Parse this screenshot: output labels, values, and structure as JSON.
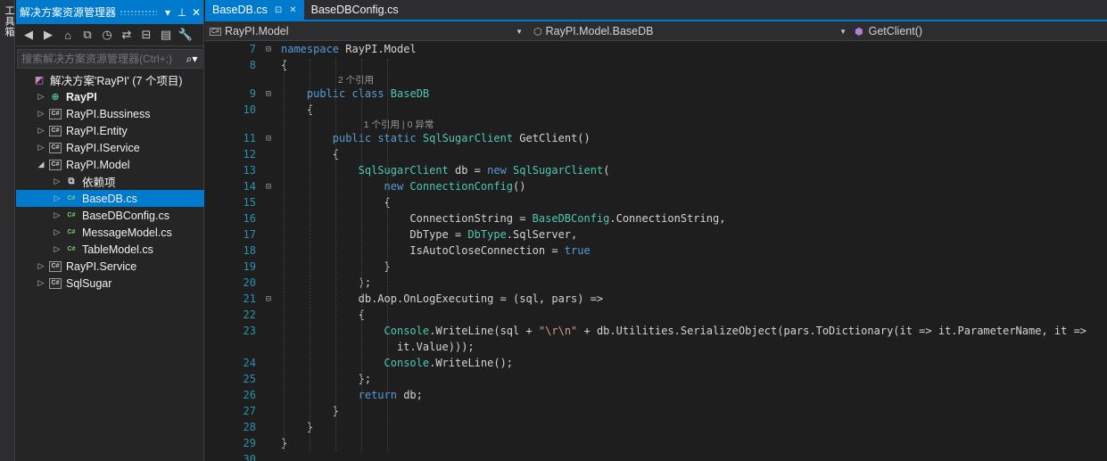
{
  "left_strip": {
    "label": "工具箱"
  },
  "solution_explorer": {
    "title": "解决方案资源管理器",
    "search_placeholder": "搜索解决方案资源管理器(Ctrl+;)",
    "tree": [
      {
        "label": "解决方案'RayPI' (7 个项目)",
        "icon": "solution-icon",
        "indent": 0,
        "arrow": "",
        "bold": false
      },
      {
        "label": "RayPI",
        "icon": "web-project-icon",
        "indent": 1,
        "arrow": "▷",
        "bold": true
      },
      {
        "label": "RayPI.Bussiness",
        "icon": "csproj-icon",
        "indent": 1,
        "arrow": "▷",
        "bold": false
      },
      {
        "label": "RayPI.Entity",
        "icon": "csproj-icon",
        "indent": 1,
        "arrow": "▷",
        "bold": false
      },
      {
        "label": "RayPI.IService",
        "icon": "csproj-icon",
        "indent": 1,
        "arrow": "▷",
        "bold": false
      },
      {
        "label": "RayPI.Model",
        "icon": "csproj-icon",
        "indent": 1,
        "arrow": "◢",
        "bold": false
      },
      {
        "label": "依赖项",
        "icon": "dependencies-icon",
        "indent": 2,
        "arrow": "▷",
        "bold": false
      },
      {
        "label": "BaseDB.cs",
        "icon": "csfile-icon",
        "indent": 2,
        "arrow": "▷",
        "bold": false,
        "selected": true
      },
      {
        "label": "BaseDBConfig.cs",
        "icon": "csfile-icon",
        "indent": 2,
        "arrow": "▷",
        "bold": false
      },
      {
        "label": "MessageModel.cs",
        "icon": "csfile-icon",
        "indent": 2,
        "arrow": "▷",
        "bold": false
      },
      {
        "label": "TableModel.cs",
        "icon": "csfile-icon",
        "indent": 2,
        "arrow": "▷",
        "bold": false
      },
      {
        "label": "RayPI.Service",
        "icon": "csproj-icon",
        "indent": 1,
        "arrow": "▷",
        "bold": false
      },
      {
        "label": "SqlSugar",
        "icon": "csproj-icon",
        "indent": 1,
        "arrow": "▷",
        "bold": false
      }
    ]
  },
  "editor": {
    "tabs": [
      {
        "label": "BaseDB.cs",
        "active": true
      },
      {
        "label": "BaseDBConfig.cs",
        "active": false
      }
    ],
    "nav": {
      "project": "RayPI.Model",
      "type": "RayPI.Model.BaseDB",
      "member": "GetClient()"
    },
    "lines": [
      {
        "no": "7",
        "fold": "⊟",
        "indent": 0,
        "tokens": [
          [
            "k",
            "namespace "
          ],
          [
            "",
            "RayPI.Model"
          ]
        ]
      },
      {
        "no": "8",
        "fold": "",
        "indent": 0,
        "tokens": [
          [
            "",
            "{"
          ]
        ]
      },
      {
        "lens": "2 个引用",
        "indent": 4
      },
      {
        "no": "9",
        "fold": "⊟",
        "indent": 4,
        "tokens": [
          [
            "k",
            "public class "
          ],
          [
            "t",
            "BaseDB"
          ]
        ]
      },
      {
        "no": "10",
        "fold": "",
        "indent": 4,
        "tokens": [
          [
            "",
            "{"
          ]
        ]
      },
      {
        "lens": "1 个引用 | 0 异常",
        "indent": 8
      },
      {
        "no": "11",
        "fold": "⊟",
        "indent": 8,
        "tokens": [
          [
            "k",
            "public static "
          ],
          [
            "t",
            "SqlSugarClient"
          ],
          [
            "",
            " GetClient()"
          ]
        ]
      },
      {
        "no": "12",
        "fold": "",
        "indent": 8,
        "tokens": [
          [
            "",
            "{"
          ]
        ]
      },
      {
        "no": "13",
        "fold": "",
        "indent": 12,
        "tokens": [
          [
            "t",
            "SqlSugarClient"
          ],
          [
            "",
            " db = "
          ],
          [
            "k",
            "new "
          ],
          [
            "t",
            "SqlSugarClient"
          ],
          [
            "",
            "("
          ]
        ]
      },
      {
        "no": "14",
        "fold": "⊟",
        "indent": 16,
        "tokens": [
          [
            "k",
            "new "
          ],
          [
            "t",
            "ConnectionConfig"
          ],
          [
            "",
            "()"
          ]
        ]
      },
      {
        "no": "15",
        "fold": "",
        "indent": 16,
        "tokens": [
          [
            "",
            "{"
          ]
        ]
      },
      {
        "no": "16",
        "fold": "",
        "indent": 20,
        "tokens": [
          [
            "",
            "ConnectionString = "
          ],
          [
            "t",
            "BaseDBConfig"
          ],
          [
            "",
            ".ConnectionString,"
          ]
        ]
      },
      {
        "no": "17",
        "fold": "",
        "indent": 20,
        "tokens": [
          [
            "",
            "DbType = "
          ],
          [
            "t",
            "DbType"
          ],
          [
            "",
            ".SqlServer,"
          ]
        ]
      },
      {
        "no": "18",
        "fold": "",
        "indent": 20,
        "tokens": [
          [
            "",
            "IsAutoCloseConnection = "
          ],
          [
            "k",
            "true"
          ]
        ]
      },
      {
        "no": "19",
        "fold": "",
        "indent": 16,
        "tokens": [
          [
            "",
            "}"
          ]
        ]
      },
      {
        "no": "20",
        "fold": "",
        "indent": 12,
        "tokens": [
          [
            "",
            ");"
          ]
        ]
      },
      {
        "no": "21",
        "fold": "⊟",
        "indent": 12,
        "tokens": [
          [
            "",
            "db.Aop.OnLogExecuting = (sql, pars) =>"
          ]
        ]
      },
      {
        "no": "22",
        "fold": "",
        "indent": 12,
        "tokens": [
          [
            "",
            "{"
          ]
        ]
      },
      {
        "no": "23",
        "fold": "",
        "indent": 16,
        "tokens": [
          [
            "t",
            "Console"
          ],
          [
            "",
            ".WriteLine(sql + "
          ],
          [
            "s",
            "\"\\r\\n\""
          ],
          [
            "",
            " + db.Utilities.SerializeObject(pars.ToDictionary(it => it.ParameterName, it =>"
          ]
        ]
      },
      {
        "no": "",
        "fold": "",
        "indent": 18,
        "tokens": [
          [
            "",
            "it.Value)));"
          ]
        ]
      },
      {
        "no": "24",
        "fold": "",
        "indent": 16,
        "tokens": [
          [
            "t",
            "Console"
          ],
          [
            "",
            ".WriteLine();"
          ]
        ]
      },
      {
        "no": "25",
        "fold": "",
        "indent": 12,
        "tokens": [
          [
            "",
            "};"
          ]
        ]
      },
      {
        "no": "26",
        "fold": "",
        "indent": 12,
        "tokens": [
          [
            "k",
            "return "
          ],
          [
            "",
            "db;"
          ]
        ]
      },
      {
        "no": "27",
        "fold": "",
        "indent": 8,
        "tokens": [
          [
            "",
            "}"
          ]
        ]
      },
      {
        "no": "28",
        "fold": "",
        "indent": 4,
        "tokens": [
          [
            "",
            "}"
          ]
        ]
      },
      {
        "no": "29",
        "fold": "",
        "indent": 0,
        "tokens": [
          [
            "",
            "}"
          ]
        ]
      },
      {
        "no": "30",
        "fold": "",
        "indent": 0,
        "tokens": []
      }
    ]
  }
}
